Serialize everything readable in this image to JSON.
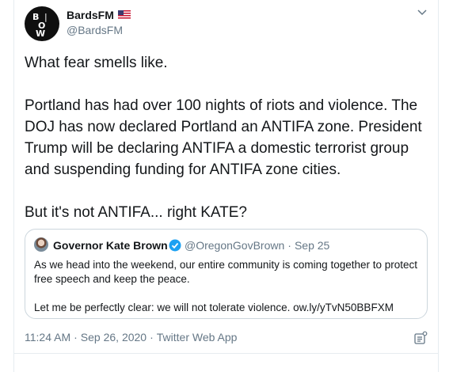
{
  "author": {
    "name": "BardsFM",
    "handle": "@BardsFM",
    "avatar_letters": [
      "B",
      "O",
      "W"
    ],
    "flag_icon": "us-flag-icon"
  },
  "tweet": {
    "paragraphs": [
      "What fear smells like.",
      "Portland has had over 100 nights of riots and violence. The DOJ has now declared Portland an ANTIFA zone. President Trump will be declaring ANTIFA a domestic terrorist group and suspending funding for ANTIFA zone cities.",
      "But it's not ANTIFA... right KATE?"
    ]
  },
  "quoted": {
    "name": "Governor Kate Brown",
    "handle": "@OregonGovBrown",
    "separator": "·",
    "date": "Sep 25",
    "verified_icon": "verified-badge-icon",
    "paragraphs": [
      "As we head into the weekend, our entire community is coming together to protect free speech and keep the peace.",
      "Let me be perfectly clear: we will not tolerate violence. ow.ly/yTvN50BBFXM"
    ]
  },
  "meta": {
    "time": "11:24 AM",
    "separator": "·",
    "date": "Sep 26, 2020",
    "source": "Twitter Web App"
  },
  "colors": {
    "text": "#14171a",
    "secondary": "#657786",
    "border": "#ccd6dd",
    "verified": "#1da1f2"
  }
}
